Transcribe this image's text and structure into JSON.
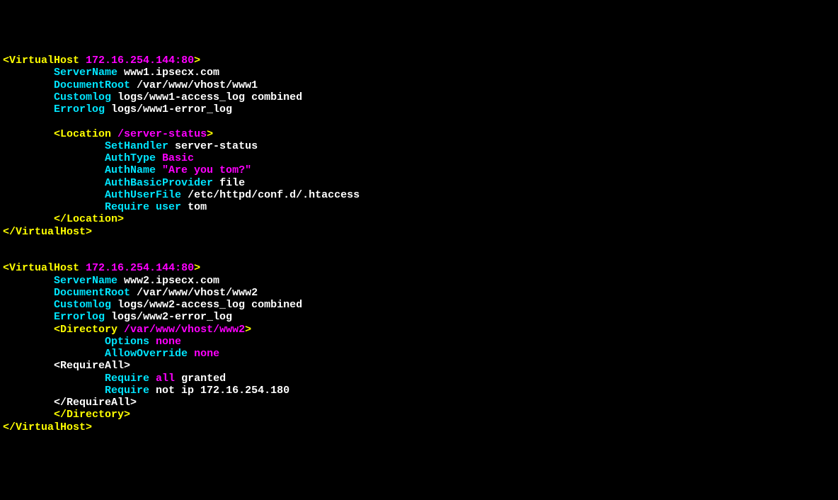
{
  "v1": {
    "open_lt": "<",
    "open_tag": "VirtualHost ",
    "ip": "172.16.254.144:80",
    "open_gt": ">",
    "sn_k": "ServerName",
    "sn_v": " www1.ipsecx.com",
    "dr_k": "DocumentRoot",
    "dr_v": " /var/www/vhost/www1",
    "cl_k": "Customlog",
    "cl_v": " logs/www1-access_log combined",
    "el_k": "Errorlog",
    "el_v": " logs/www1-error_log",
    "loc_open_lt": "<",
    "loc_open_tag": "Location ",
    "loc_path": "/server-status",
    "loc_open_gt": ">",
    "sh_k": "SetHandler",
    "sh_v": " server-status",
    "at_k": "AuthType ",
    "at_v": "Basic",
    "an_k": "AuthName ",
    "an_v": "\"Are you tom?\"",
    "abp_k": "AuthBasicProvider",
    "abp_v": " file",
    "auf_k": "AuthUserFile",
    "auf_v": " /etc/httpd/conf.d/.htaccess",
    "req_k": "Require user",
    "req_v": " tom",
    "loc_close": "</Location>",
    "close": "</VirtualHost>"
  },
  "v2": {
    "open_lt": "<",
    "open_tag": "VirtualHost ",
    "ip": "172.16.254.144:80",
    "open_gt": ">",
    "sn_k": "ServerName",
    "sn_v": " www2.ipsecx.com",
    "dr_k": "DocumentRoot",
    "dr_v": " /var/www/vhost/www2",
    "cl_k": "Customlog",
    "cl_v": " logs/www2-access_log combined",
    "el_k": "Errorlog",
    "el_v": " logs/www2-error_log",
    "dir_open_lt": "<",
    "dir_open_tag": "Directory ",
    "dir_path": "/var/www/vhost/www2",
    "dir_open_gt": ">",
    "opt_k": "Options ",
    "opt_v": "none",
    "ao_k": "AllowOverride ",
    "ao_v": "none",
    "ra_open": "<RequireAll>",
    "req1_k": "Require ",
    "req1_m": "all",
    "req1_v": " granted",
    "req2_k": "Require",
    "req2_v": " not ip 172.16.254.180",
    "ra_close": "</RequireAll>",
    "dir_close": "</Directory>",
    "close": "</VirtualHost>"
  }
}
